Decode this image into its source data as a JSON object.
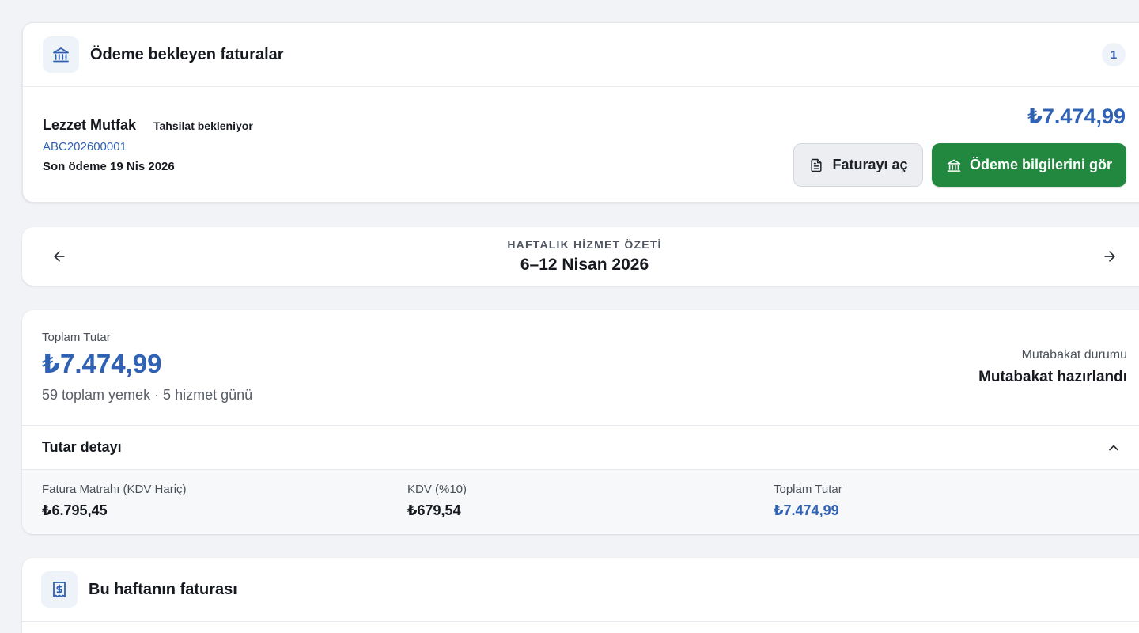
{
  "pending": {
    "title": "Ödeme bekleyen faturalar",
    "count": "1",
    "vendor": "Lezzet Mutfak",
    "status": "Tahsilat bekleniyor",
    "invoice_no": "ABC202600001",
    "due": "Son ödeme 19 Nis 2026",
    "amount": "₺7.474,99",
    "open_invoice_label": "Faturayı aç",
    "payment_info_label": "Ödeme bilgilerini gör",
    "icons": {
      "header": "bank-icon",
      "open": "document-icon",
      "payment": "bank-icon"
    }
  },
  "week": {
    "caption": "HAFTALIK HİZMET ÖZETİ",
    "range": "6–12 Nisan 2026",
    "icons": {
      "prev": "arrow-left-icon",
      "next": "arrow-right-icon"
    }
  },
  "summary": {
    "total_label": "Toplam Tutar",
    "total_amount": "₺7.474,99",
    "meta": "59 toplam yemek · 5 hizmet günü",
    "recon_label": "Mutabakat durumu",
    "recon_value": "Mutabakat hazırlandı",
    "detail_title": "Tutar detayı",
    "details": [
      {
        "label": "Fatura Matrahı (KDV Hariç)",
        "value": "₺6.795,45"
      },
      {
        "label": "KDV (%10)",
        "value": "₺679,54"
      },
      {
        "label": "Toplam Tutar",
        "value": "₺7.474,99"
      }
    ]
  },
  "invoice": {
    "title": "Bu haftanın faturası",
    "icon": "receipt-dollar-icon"
  },
  "colors": {
    "background": "#f1f3f6",
    "accent_blue": "#2f62b5",
    "primary_green": "#22883f",
    "icon_tile": "#eef2f9"
  }
}
